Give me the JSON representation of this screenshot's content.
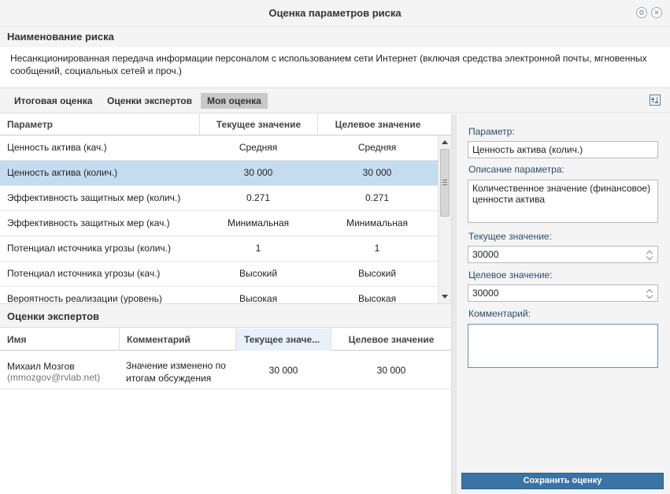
{
  "window": {
    "title": "Оценка параметров риска",
    "icons": [
      "settings-icon",
      "close-icon"
    ]
  },
  "risk": {
    "heading": "Наименование риска",
    "text": "Несанкционированная передача информации персоналом с использованием сети Интернет (включая средства электронной почты, мгновенных сообщений, социальных сетей и проч.)"
  },
  "tabs": [
    {
      "label": "Итоговая оценка",
      "active": false
    },
    {
      "label": "Оценки экспертов",
      "active": false
    },
    {
      "label": "Моя оценка",
      "active": true
    }
  ],
  "params_grid": {
    "columns": [
      "Параметр",
      "Текущее значение",
      "Целевое значение"
    ],
    "rows": [
      {
        "param": "Ценность актива (кач.)",
        "current": "Средняя",
        "target": "Средняя",
        "selected": false
      },
      {
        "param": "Ценность актива (колич.)",
        "current": "30 000",
        "target": "30 000",
        "selected": true
      },
      {
        "param": "Эффективность защитных мер (колич.)",
        "current": "0.271",
        "target": "0.271",
        "selected": false
      },
      {
        "param": "Эффективность защитных мер (кач.)",
        "current": "Минимальная",
        "target": "Минимальная",
        "selected": false
      },
      {
        "param": "Потенциал источника угрозы (колич.)",
        "current": "1",
        "target": "1",
        "selected": false
      },
      {
        "param": "Потенциал источника угрозы (кач.)",
        "current": "Высокий",
        "target": "Высокий",
        "selected": false
      },
      {
        "param": "Вероятность реализации (уровень)",
        "current": "Высокая",
        "target": "Высокая",
        "selected": false
      }
    ]
  },
  "experts": {
    "heading": "Оценки экспертов",
    "columns": [
      "Имя",
      "Комментарий",
      "Текущее значе...",
      "Целевое значение"
    ],
    "rows": [
      {
        "name": "Михаил Мозгов",
        "email": "(mmozgov@rvlab.net)",
        "comment": "Значение изменено по итогам обсуждения",
        "current": "30 000",
        "target": "30 000"
      }
    ]
  },
  "detail": {
    "param_label": "Параметр:",
    "param_value": "Ценность актива (колич.)",
    "desc_label": "Описание параметра:",
    "desc_value": "Количественное значение (финансовое) ценности актива",
    "current_label": "Текущее значение:",
    "current_value": "30000",
    "target_label": "Целевое значение:",
    "target_value": "30000",
    "comment_label": "Комментарий:",
    "comment_value": "",
    "save_label": "Сохранить оценку"
  }
}
